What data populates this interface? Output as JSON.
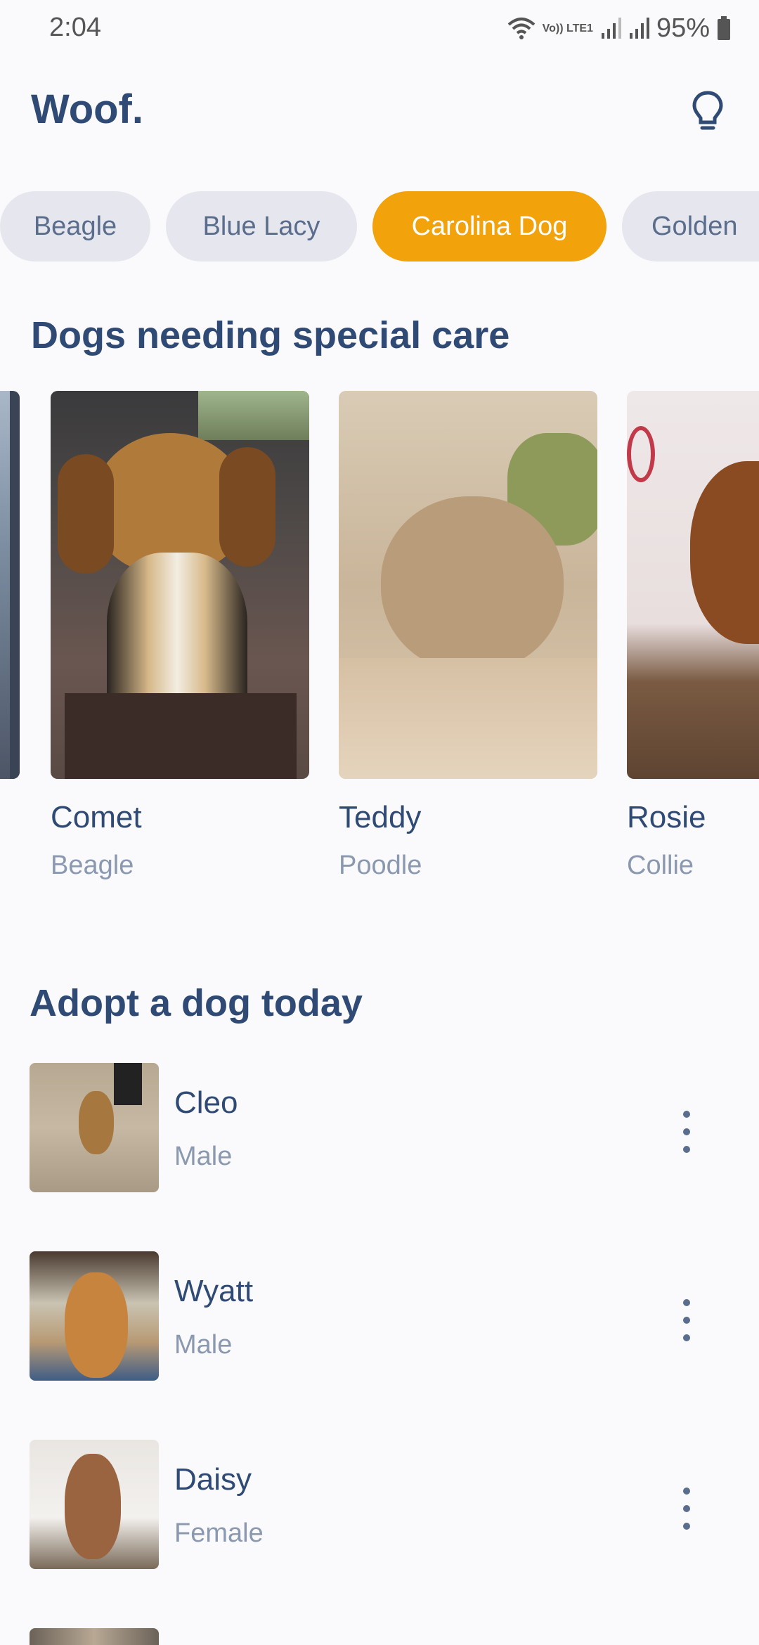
{
  "status_bar": {
    "time": "2:04",
    "battery": "95%",
    "network_label": "Vo)) LTE1",
    "icons": [
      "wifi-icon",
      "signal-icon",
      "signal-icon",
      "battery-icon"
    ]
  },
  "header": {
    "title": "Woof.",
    "theme_icon": "lightbulb-icon"
  },
  "breeds": [
    {
      "label": "Beagle",
      "selected": false
    },
    {
      "label": "Blue Lacy",
      "selected": false
    },
    {
      "label": "Carolina Dog",
      "selected": true
    },
    {
      "label": "Golden",
      "selected": false
    }
  ],
  "special_care": {
    "title": "Dogs needing special care",
    "dogs": [
      {
        "name": "Comet",
        "breed": "Beagle"
      },
      {
        "name": "Teddy",
        "breed": "Poodle"
      },
      {
        "name": "Rosie",
        "breed": "Collie"
      }
    ]
  },
  "adopt": {
    "title": "Adopt a dog today",
    "dogs": [
      {
        "name": "Cleo",
        "sex": "Male"
      },
      {
        "name": "Wyatt",
        "sex": "Male"
      },
      {
        "name": "Daisy",
        "sex": "Female"
      }
    ]
  },
  "colors": {
    "accent": "#f2a20a",
    "primary_text": "#2f4a74",
    "secondary_text": "#8a99b0",
    "chip_bg": "#e6e7ee"
  }
}
